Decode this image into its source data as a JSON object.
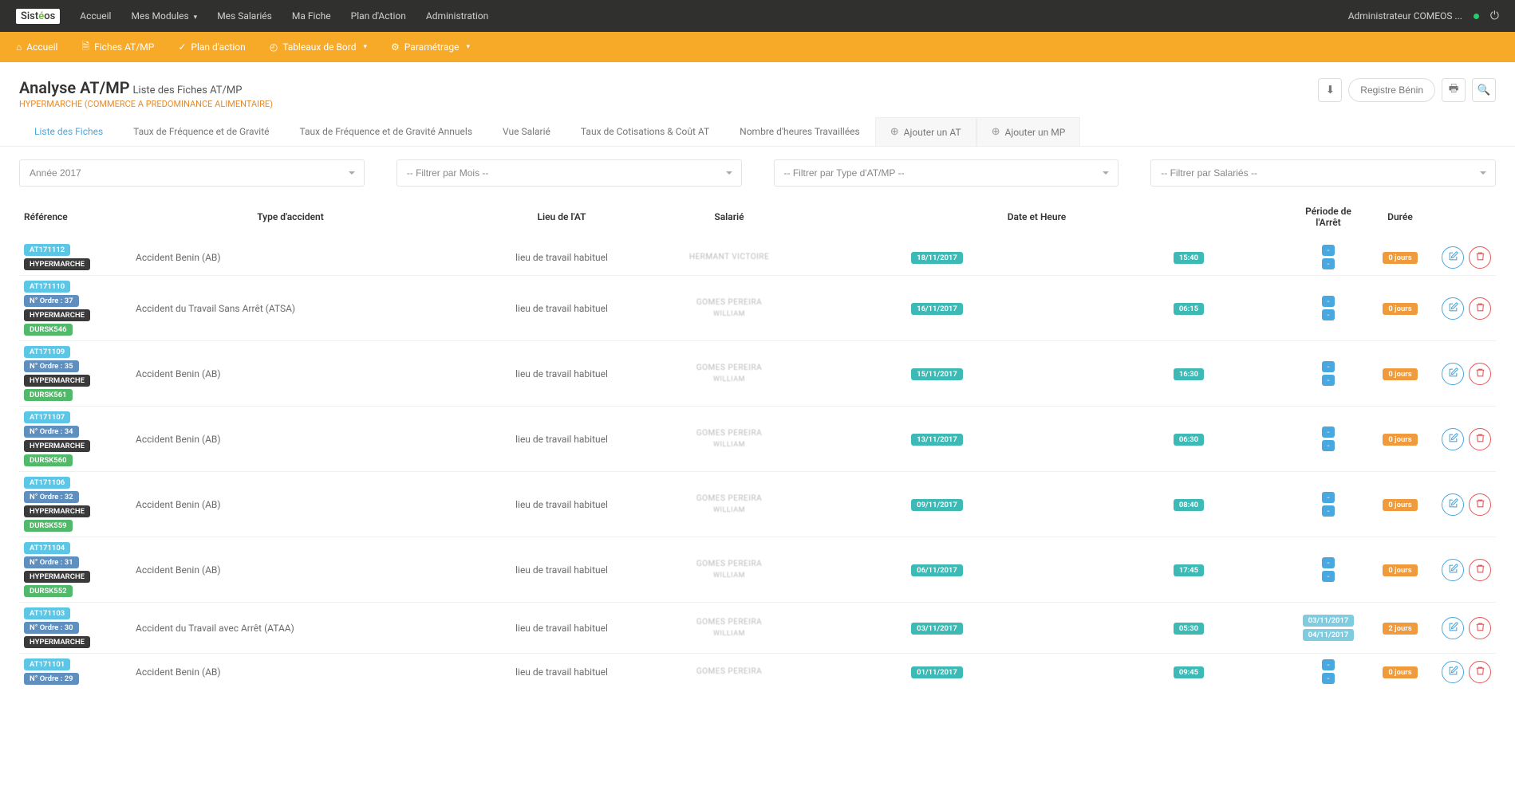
{
  "topnav": {
    "logo": "Sistéos",
    "items": [
      "Accueil",
      "Mes Modules",
      "Mes Salariés",
      "Ma Fiche",
      "Plan d'Action",
      "Administration"
    ],
    "user": "Administrateur COMEOS ..."
  },
  "subnav": {
    "items": [
      {
        "icon": "home",
        "label": "Accueil"
      },
      {
        "icon": "file",
        "label": "Fiches AT/MP"
      },
      {
        "icon": "check",
        "label": "Plan d'action"
      },
      {
        "icon": "chart",
        "label": "Tableaux de Bord",
        "caret": true
      },
      {
        "icon": "gear",
        "label": "Paramétrage",
        "caret": true
      }
    ]
  },
  "page": {
    "title": "Analyse AT/MP",
    "subtitle": "Liste des Fiches AT/MP",
    "meta": "HYPERMARCHE (COMMERCE A PREDOMINANCE ALIMENTAIRE)",
    "register_btn": "Registre Bénin"
  },
  "tabs": [
    {
      "label": "Liste des Fiches",
      "active": true
    },
    {
      "label": "Taux de Fréquence et de Gravité"
    },
    {
      "label": "Taux de Fréquence et de Gravité Annuels"
    },
    {
      "label": "Vue Salarié"
    },
    {
      "label": "Taux de Cotisations & Coût AT"
    },
    {
      "label": "Nombre d'heures Travaillées"
    },
    {
      "label": "Ajouter un AT",
      "add": true
    },
    {
      "label": "Ajouter un MP",
      "add": true
    }
  ],
  "filters": {
    "year": "Année 2017",
    "month": "-- Filtrer par Mois --",
    "type": "-- Filtrer par Type d'AT/MP --",
    "salarie": "-- Filtrer par Salariés --"
  },
  "columns": {
    "ref": "Référence",
    "type": "Type d'accident",
    "lieu": "Lieu de l'AT",
    "salarie": "Salarié",
    "date": "Date et Heure",
    "period": "Période de l'Arrêt",
    "duree": "Durée"
  },
  "rows": [
    {
      "ref": {
        "at": "AT171112",
        "etab": "HYPERMARCHE"
      },
      "type": "Accident Benin (AB)",
      "lieu": "lieu de travail habituel",
      "salarie": {
        "l1": "HERMANT VICTOIRE",
        "l2": ""
      },
      "date": "18/11/2017",
      "heure": "15:40",
      "period": null,
      "duree": "0 jours"
    },
    {
      "ref": {
        "at": "AT171110",
        "ordre": "N° Ordre : 37",
        "etab": "HYPERMARCHE",
        "dursk": "DURSK546"
      },
      "type": "Accident du Travail Sans Arrêt (ATSA)",
      "lieu": "lieu de travail habituel",
      "salarie": {
        "l1": "GOMES PEREIRA",
        "l2": "WILLIAM"
      },
      "date": "16/11/2017",
      "heure": "06:15",
      "period": null,
      "duree": "0 jours"
    },
    {
      "ref": {
        "at": "AT171109",
        "ordre": "N° Ordre : 35",
        "etab": "HYPERMARCHE",
        "dursk": "DURSK561"
      },
      "type": "Accident Benin (AB)",
      "lieu": "lieu de travail habituel",
      "salarie": {
        "l1": "GOMES PEREIRA",
        "l2": "WILLIAM"
      },
      "date": "15/11/2017",
      "heure": "16:30",
      "period": null,
      "duree": "0 jours"
    },
    {
      "ref": {
        "at": "AT171107",
        "ordre": "N° Ordre : 34",
        "etab": "HYPERMARCHE",
        "dursk": "DURSK560"
      },
      "type": "Accident Benin (AB)",
      "lieu": "lieu de travail habituel",
      "salarie": {
        "l1": "GOMES PEREIRA",
        "l2": "WILLIAM"
      },
      "date": "13/11/2017",
      "heure": "06:30",
      "period": null,
      "duree": "0 jours"
    },
    {
      "ref": {
        "at": "AT171106",
        "ordre": "N° Ordre : 32",
        "etab": "HYPERMARCHE",
        "dursk": "DURSK559"
      },
      "type": "Accident Benin (AB)",
      "lieu": "lieu de travail habituel",
      "salarie": {
        "l1": "GOMES PEREIRA",
        "l2": "WILLIAM"
      },
      "date": "09/11/2017",
      "heure": "08:40",
      "period": null,
      "duree": "0 jours"
    },
    {
      "ref": {
        "at": "AT171104",
        "ordre": "N° Ordre : 31",
        "etab": "HYPERMARCHE",
        "dursk": "DURSK552"
      },
      "type": "Accident Benin (AB)",
      "lieu": "lieu de travail habituel",
      "salarie": {
        "l1": "GOMES PEREIRA",
        "l2": "WILLIAM"
      },
      "date": "06/11/2017",
      "heure": "17:45",
      "period": null,
      "duree": "0 jours"
    },
    {
      "ref": {
        "at": "AT171103",
        "ordre": "N° Ordre : 30",
        "etab": "HYPERMARCHE"
      },
      "type": "Accident du Travail avec Arrêt (ATAA)",
      "lieu": "lieu de travail habituel",
      "salarie": {
        "l1": "GOMES PEREIRA",
        "l2": "WILLIAM"
      },
      "date": "03/11/2017",
      "heure": "05:30",
      "period": {
        "from": "03/11/2017",
        "to": "04/11/2017"
      },
      "duree": "2 jours"
    },
    {
      "ref": {
        "at": "AT171101",
        "ordre": "N° Ordre : 29"
      },
      "type": "Accident Benin (AB)",
      "lieu": "lieu de travail habituel",
      "salarie": {
        "l1": "GOMES PEREIRA",
        "l2": ""
      },
      "date": "01/11/2017",
      "heure": "09:45",
      "period": null,
      "duree": "0 jours"
    }
  ]
}
